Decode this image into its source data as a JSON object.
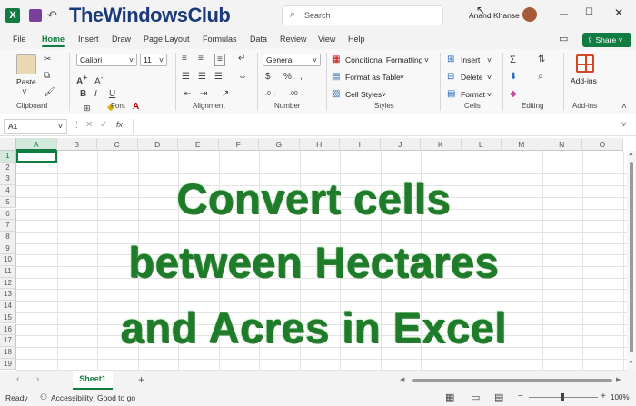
{
  "titlebar": {
    "brand": "TheWindowsClub",
    "search_placeholder": "Search",
    "user_name": "Anand Khanse",
    "minimize": "—",
    "maximize": "☐"
  },
  "menu": {
    "tabs": [
      "File",
      "Home",
      "Insert",
      "Draw",
      "Page Layout",
      "Formulas",
      "Data",
      "Review",
      "View",
      "Help"
    ],
    "share": "Share"
  },
  "ribbon": {
    "paste": "Paste",
    "clipboard": "Clipboard",
    "font_name": "Calibri",
    "font_size": "11",
    "font_group": "Font",
    "alignment_group": "Alignment",
    "number_format": "General",
    "number_group": "Number",
    "conditional_formatting": "Conditional Formatting",
    "format_as_table": "Format as Table",
    "cell_styles": "Cell Styles",
    "styles_group": "Styles",
    "insert": "Insert",
    "delete": "Delete",
    "format": "Format",
    "cells_group": "Cells",
    "editing_group": "Editing",
    "addins": "Add-ins",
    "addins_group": "Add-ins"
  },
  "formula": {
    "name_box": "A1",
    "fx": "fx"
  },
  "grid": {
    "columns": [
      "A",
      "B",
      "C",
      "D",
      "E",
      "F",
      "G",
      "H",
      "I",
      "J",
      "K",
      "L",
      "M",
      "N",
      "O"
    ],
    "rows": [
      "1",
      "2",
      "3",
      "4",
      "5",
      "6",
      "7",
      "8",
      "9",
      "10",
      "11",
      "12",
      "13",
      "14",
      "15",
      "16",
      "17",
      "18",
      "19"
    ]
  },
  "overlay": {
    "line1": "Convert cells",
    "line2": "between Hectares",
    "line3": "and Acres in Excel"
  },
  "sheets": {
    "active": "Sheet1",
    "add": "+"
  },
  "status": {
    "ready": "Ready",
    "accessibility": "Accessibility: Good to go",
    "zoom": "100%"
  },
  "colors": {
    "excel_green": "#107c41",
    "overlay_green": "#1e7b2a"
  }
}
